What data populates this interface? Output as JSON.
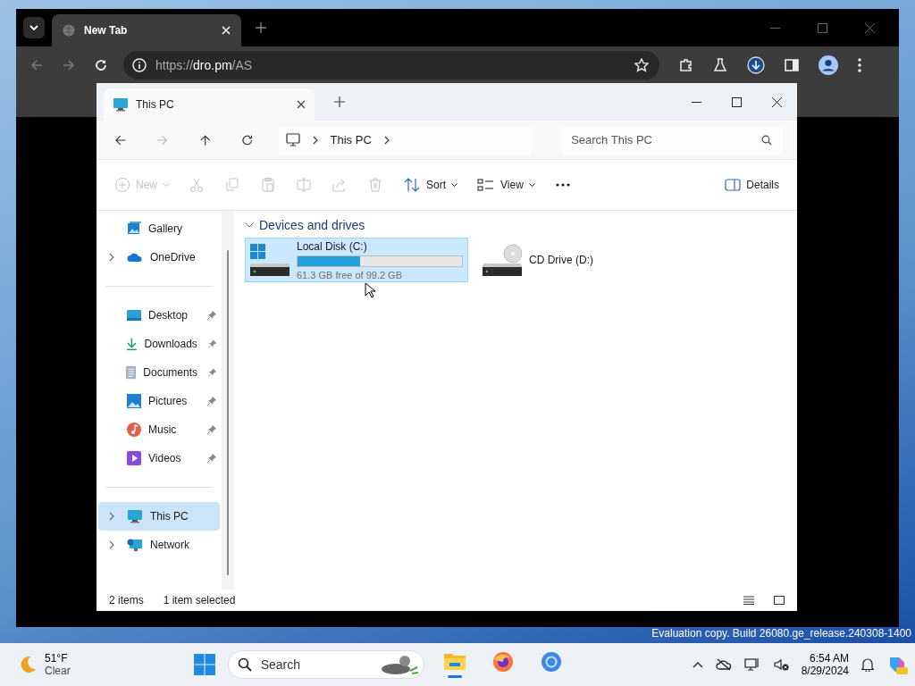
{
  "browser": {
    "tab_title": "New Tab",
    "url_host": "dro.pm",
    "url_scheme": "https://",
    "url_path": "/AS"
  },
  "explorer": {
    "tab_title": "This PC",
    "breadcrumb": [
      "This PC"
    ],
    "search_placeholder": "Search This PC",
    "toolbar": [
      {
        "kind": "new",
        "label": "New",
        "disabled": true
      },
      {
        "kind": "cut",
        "disabled": true
      },
      {
        "kind": "copy",
        "disabled": true
      },
      {
        "kind": "paste",
        "disabled": true
      },
      {
        "kind": "rename",
        "disabled": true
      },
      {
        "kind": "share",
        "disabled": true
      },
      {
        "kind": "delete",
        "disabled": true
      },
      {
        "kind": "sort",
        "label": "Sort",
        "disabled": false
      },
      {
        "kind": "view",
        "label": "View",
        "disabled": false
      },
      {
        "kind": "more",
        "disabled": false
      }
    ],
    "details_label": "Details",
    "sidebar": [
      [
        {
          "kind": "gallery",
          "label": "Gallery",
          "pinned": false,
          "expandable": false,
          "selected": false
        },
        {
          "kind": "onedrive",
          "label": "OneDrive",
          "pinned": false,
          "expandable": true,
          "selected": false
        }
      ],
      [
        {
          "kind": "desktop",
          "label": "Desktop",
          "pinned": true,
          "expandable": false,
          "selected": false
        },
        {
          "kind": "downloads",
          "label": "Downloads",
          "pinned": true,
          "expandable": false,
          "selected": false
        },
        {
          "kind": "documents",
          "label": "Documents",
          "pinned": true,
          "expandable": false,
          "selected": false
        },
        {
          "kind": "pictures",
          "label": "Pictures",
          "pinned": true,
          "expandable": false,
          "selected": false
        },
        {
          "kind": "music",
          "label": "Music",
          "pinned": true,
          "expandable": false,
          "selected": false
        },
        {
          "kind": "videos",
          "label": "Videos",
          "pinned": true,
          "expandable": false,
          "selected": false
        }
      ],
      [
        {
          "kind": "pc",
          "label": "This PC",
          "pinned": false,
          "expandable": true,
          "selected": true
        },
        {
          "kind": "network",
          "label": "Network",
          "pinned": false,
          "expandable": true,
          "selected": false
        }
      ]
    ],
    "section": {
      "title": "Devices and drives",
      "expanded": true
    },
    "drives": [
      {
        "kind": "hdd",
        "name": "Local Disk (C:)",
        "level": 0.38,
        "info": "61.3 GB free of 99.2 GB",
        "selected": true
      },
      {
        "kind": "cd",
        "name": "CD Drive (D:)",
        "selected": false
      }
    ],
    "status": [
      "2 items",
      "1 item selected"
    ]
  },
  "watermark": "Evaluation copy. Build 26080.ge_release.240308-1400",
  "taskbar": {
    "temperature": "51°F",
    "condition": "Clear",
    "search_placeholder": "Search",
    "apps": [
      {
        "kind": "explorer",
        "active": true
      },
      {
        "kind": "firefox",
        "active": false
      },
      {
        "kind": "chrome",
        "active": false
      }
    ],
    "time": "6:54 AM",
    "date": "8/29/2024"
  }
}
